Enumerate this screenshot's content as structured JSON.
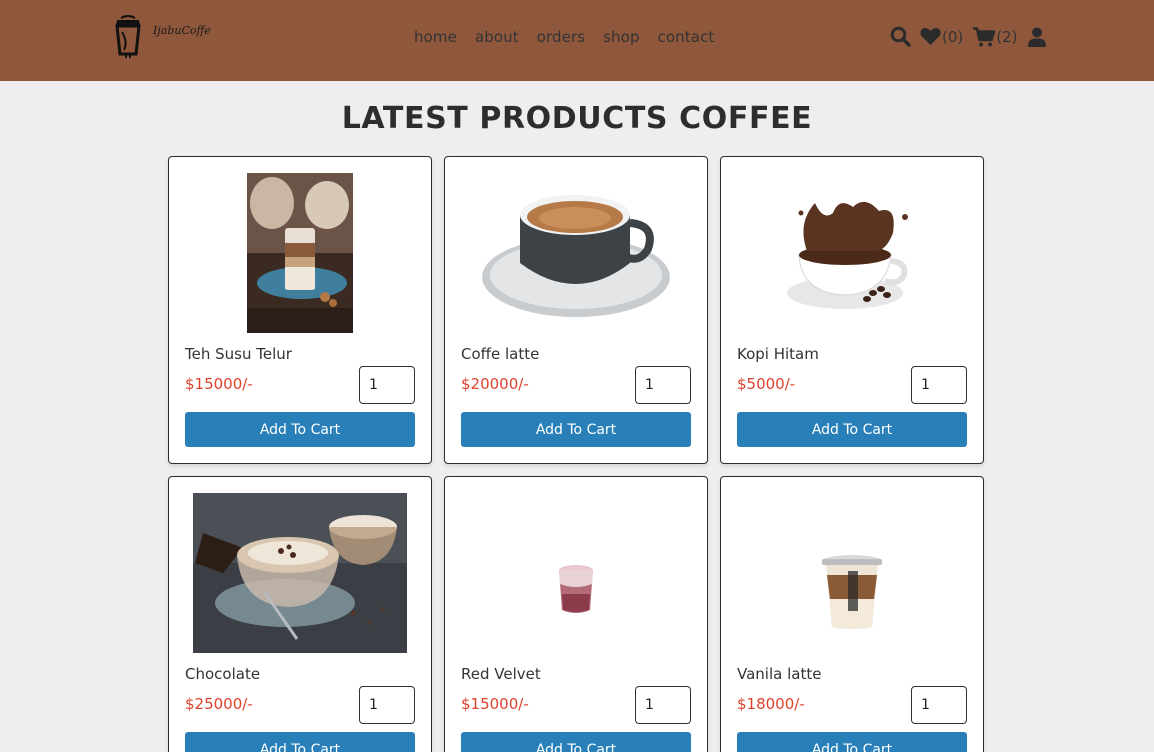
{
  "brand": {
    "name": "IjabuCoffe"
  },
  "nav": [
    "home",
    "about",
    "orders",
    "shop",
    "contact"
  ],
  "header_icons": {
    "wishlist_count": "(0)",
    "cart_count": "(2)"
  },
  "page_title": "LATEST PRODUCTS COFFEE",
  "colors": {
    "header": "#8f583c",
    "accent": "#2980b9",
    "price": "#e0412d",
    "background": "#eeeeee"
  },
  "products": [
    {
      "name": "Teh Susu Telur",
      "price": "$15000/-",
      "qty": "1",
      "button": "Add To Cart",
      "image": "layered-latte-glass-photo"
    },
    {
      "name": "Coffe latte",
      "price": "$20000/-",
      "qty": "1",
      "button": "Add To Cart",
      "image": "espresso-cup-saucer-photo"
    },
    {
      "name": "Kopi Hitam",
      "price": "$5000/-",
      "qty": "1",
      "button": "Add To Cart",
      "image": "coffee-splash-cup-photo"
    },
    {
      "name": "Chocolate",
      "price": "$25000/-",
      "qty": "1",
      "button": "Add To Cart",
      "image": "hot-chocolate-cups-photo"
    },
    {
      "name": "Red Velvet",
      "price": "$15000/-",
      "qty": "1",
      "button": "Add To Cart",
      "image": "red-velvet-glass-photo"
    },
    {
      "name": "Vanila latte",
      "price": "$18000/-",
      "qty": "1",
      "button": "Add To Cart",
      "image": "iced-vanilla-latte-cup-photo"
    }
  ]
}
